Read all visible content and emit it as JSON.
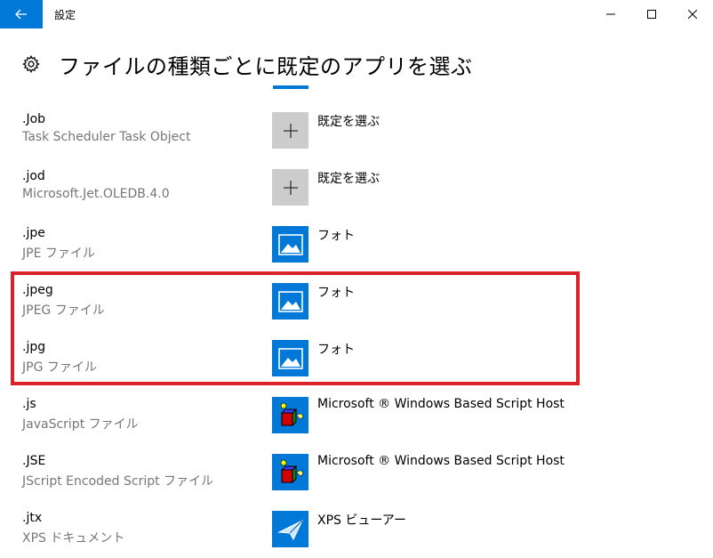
{
  "window": {
    "title": "設定"
  },
  "header": {
    "title": "ファイルの種類ごとに既定のアプリを選ぶ"
  },
  "associations": [
    {
      "extension": ".Job",
      "description": "Task Scheduler Task Object",
      "app": "既定を選ぶ",
      "icon": "plus-icon"
    },
    {
      "extension": ".jod",
      "description": "Microsoft.Jet.OLEDB.4.0",
      "app": "既定を選ぶ",
      "icon": "plus-icon"
    },
    {
      "extension": ".jpe",
      "description": "JPE ファイル",
      "app": "フォト",
      "icon": "photos-app-icon"
    },
    {
      "extension": ".jpeg",
      "description": "JPEG ファイル",
      "app": "フォト",
      "icon": "photos-app-icon"
    },
    {
      "extension": ".jpg",
      "description": "JPG ファイル",
      "app": "フォト",
      "icon": "photos-app-icon"
    },
    {
      "extension": ".js",
      "description": "JavaScript ファイル",
      "app": "Microsoft ® Windows Based Script Host",
      "icon": "script-host-icon"
    },
    {
      "extension": ".JSE",
      "description": "JScript Encoded Script ファイル",
      "app": "Microsoft ® Windows Based Script Host",
      "icon": "script-host-icon"
    },
    {
      "extension": ".jtx",
      "description": "XPS ドキュメント",
      "app": "XPS ビューアー",
      "icon": "xps-viewer-icon"
    }
  ],
  "colors": {
    "accent": "#0078d7",
    "highlight": "#d9222a",
    "secondary_text": "#767676",
    "choose_tile": "#cccccc"
  }
}
